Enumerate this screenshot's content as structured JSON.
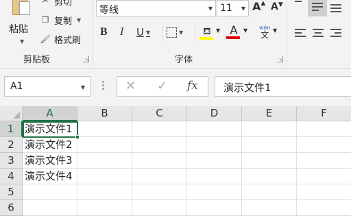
{
  "ribbon": {
    "clipboard": {
      "paste_label": "粘贴",
      "cut_label": "剪切",
      "copy_label": "复制",
      "format_painter_label": "格式刷",
      "group_label": "剪贴板"
    },
    "font": {
      "font_name": "等线",
      "font_size": "11",
      "bold": "B",
      "italic": "I",
      "underline": "U",
      "font_color_glyph": "A",
      "phonetic_top": "wén",
      "phonetic_bottom": "文",
      "grow_glyph": "A",
      "shrink_glyph": "A",
      "group_label": "字体",
      "highlight_color": "#ffff00",
      "font_color": "#e00000"
    }
  },
  "formula_bar": {
    "name_box": "A1",
    "cancel_glyph": "✕",
    "enter_glyph": "✓",
    "fx_glyph": "fx",
    "value": "演示文件1"
  },
  "grid": {
    "columns": [
      "A",
      "B",
      "C",
      "D",
      "E",
      "F"
    ],
    "rows": [
      "1",
      "2",
      "3",
      "4",
      "5",
      "6"
    ],
    "cells": [
      "演示文件1",
      "演示文件2",
      "演示文件3",
      "演示文件4",
      "",
      ""
    ]
  },
  "colors": {
    "accent": "#217346"
  }
}
